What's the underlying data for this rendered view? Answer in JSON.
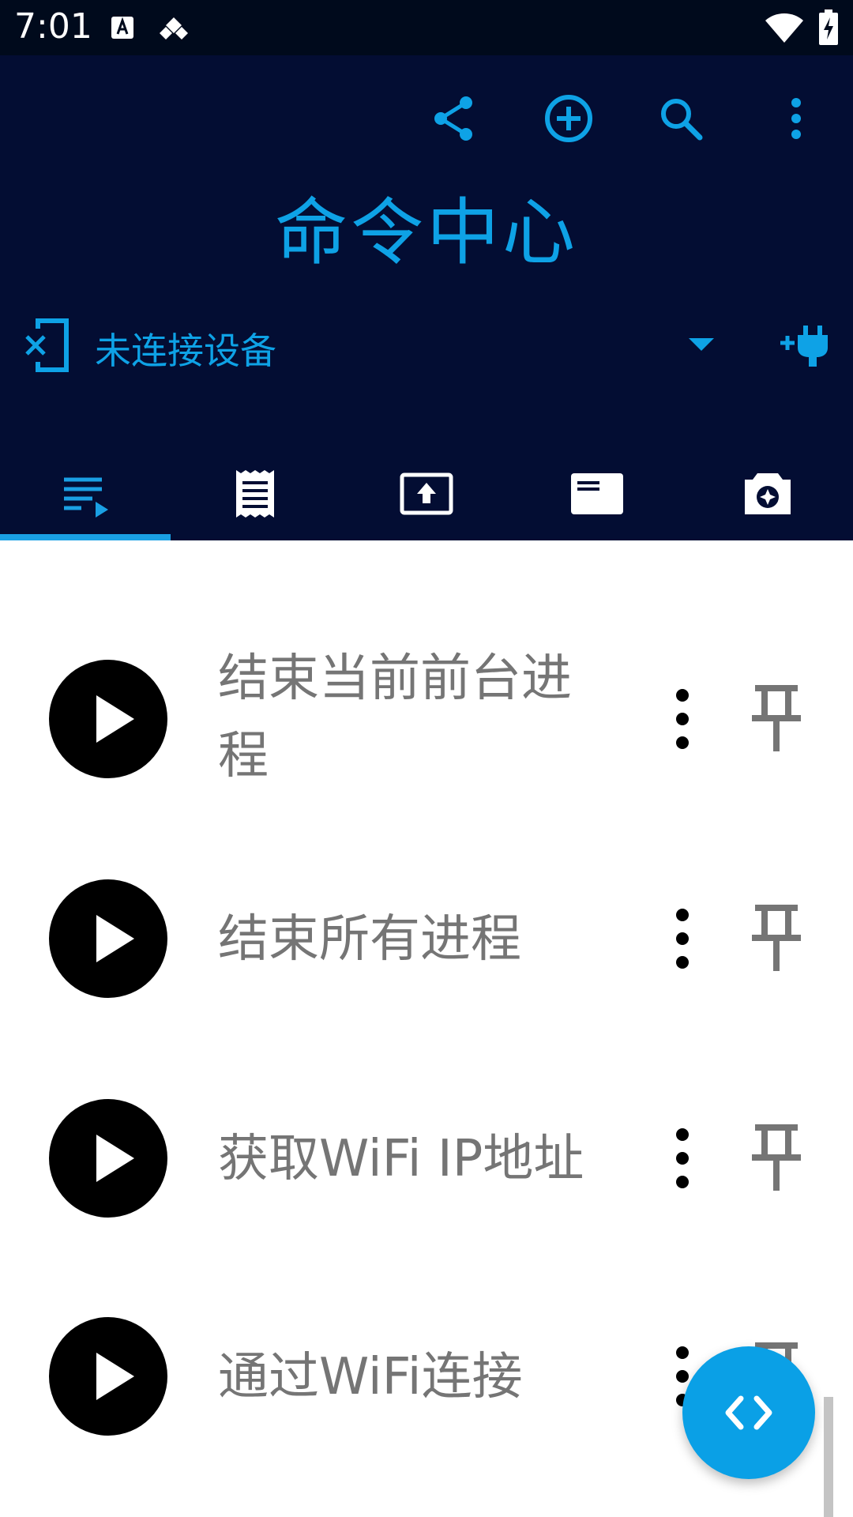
{
  "status_bar": {
    "time": "7:01"
  },
  "app_bar": {
    "title": "命令中心"
  },
  "device": {
    "label": "未连接设备"
  },
  "commands": [
    {
      "label": "结束当前前台进程"
    },
    {
      "label": "结束所有进程"
    },
    {
      "label": "获取WiFi IP地址"
    },
    {
      "label": "通过WiFi连接"
    }
  ],
  "colors": {
    "app_bar_bg": "#030d33",
    "accent": "#0ea2e6",
    "label_text": "#757575",
    "fab": "#0aa0e6"
  },
  "icons": {
    "actions": [
      "share-icon",
      "add-circle-icon",
      "search-icon",
      "more-vert-icon"
    ],
    "tabs": [
      "playlist-icon",
      "receipt-icon",
      "upload-screen-icon",
      "card-icon",
      "camera-icon"
    ],
    "fab": "code-icon"
  }
}
